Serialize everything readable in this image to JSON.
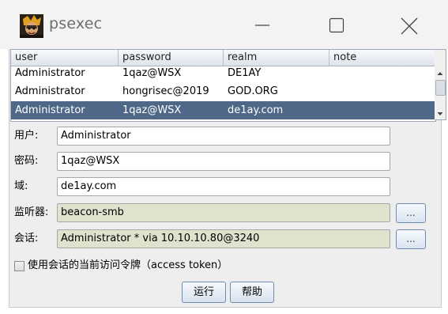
{
  "window": {
    "title": "psexec",
    "icon": "app-avatar-icon"
  },
  "table": {
    "columns": [
      "user",
      "password",
      "realm",
      "note"
    ],
    "rows": [
      {
        "user": "Administrator",
        "password": "1qaz@WSX",
        "realm": "DE1AY",
        "note": "",
        "selected": false
      },
      {
        "user": "Administrator",
        "password": "hongrisec@2019",
        "realm": "GOD.ORG",
        "note": "",
        "selected": false
      },
      {
        "user": "Administrator",
        "password": "1qaz@WSX",
        "realm": "de1ay.com",
        "note": "",
        "selected": true
      }
    ]
  },
  "form": {
    "user_label": "用户:",
    "user_value": "Administrator",
    "password_label": "密码:",
    "password_value": "1qaz@WSX",
    "domain_label": "域:",
    "domain_value": "de1ay.com",
    "listener_label": "监听器:",
    "listener_value": "beacon-smb",
    "session_label": "会话:",
    "session_value": "Administrator * via  10.10.10.80@3240",
    "browse_label": "...",
    "token_checkbox_label": "使用会话的当前访问令牌（access token）",
    "token_checked": false
  },
  "buttons": {
    "run": "运行",
    "help": "帮助"
  },
  "colors": {
    "selected_row": "#4f6887",
    "readonly_field": "#dde3cc",
    "header_gradient_end": "#dde3ea"
  }
}
